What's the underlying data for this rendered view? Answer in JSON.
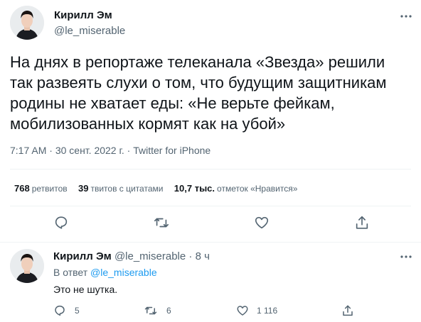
{
  "main_tweet": {
    "author_name": "Кирилл Эм",
    "author_handle": "@le_miserable",
    "text_lines": [
      "На днях в репортаже телеканала «Звезда» решили",
      "так развеять слухи о том, что будущим защитникам",
      "родины не хватает еды: «Не верьте фейкам,",
      "мобилизованных кормят как на убой»"
    ],
    "time": "7:17 AM",
    "sep1": " · ",
    "date": "30 сент. 2022 г.",
    "sep2": " · ",
    "source": "Twitter for iPhone",
    "stats": {
      "retweets_count": "768",
      "retweets_label": "ретвитов",
      "quotes_count": "39",
      "quotes_label": "твитов с цитатами",
      "likes_count": "10,7 тыс.",
      "likes_label": "отметок «Нравится»"
    }
  },
  "reply": {
    "author_name": "Кирилл Эм",
    "author_handle": "@le_miserable",
    "sep": " · ",
    "time": "8 ч",
    "reply_prefix": "В ответ ",
    "reply_mention": "@le_miserable",
    "text": "Это не шутка.",
    "reply_count": "5",
    "retweet_count": "6",
    "like_count": "1 116"
  },
  "icons": {
    "more": "more-dots-icon",
    "reply": "speech-bubble-icon",
    "retweet": "retweet-arrows-icon",
    "like": "heart-outline-icon",
    "share": "share-upload-icon"
  },
  "colors": {
    "text_primary": "#0f1419",
    "text_secondary": "#536471",
    "link": "#1d9bf0",
    "divider": "#eff3f4"
  }
}
